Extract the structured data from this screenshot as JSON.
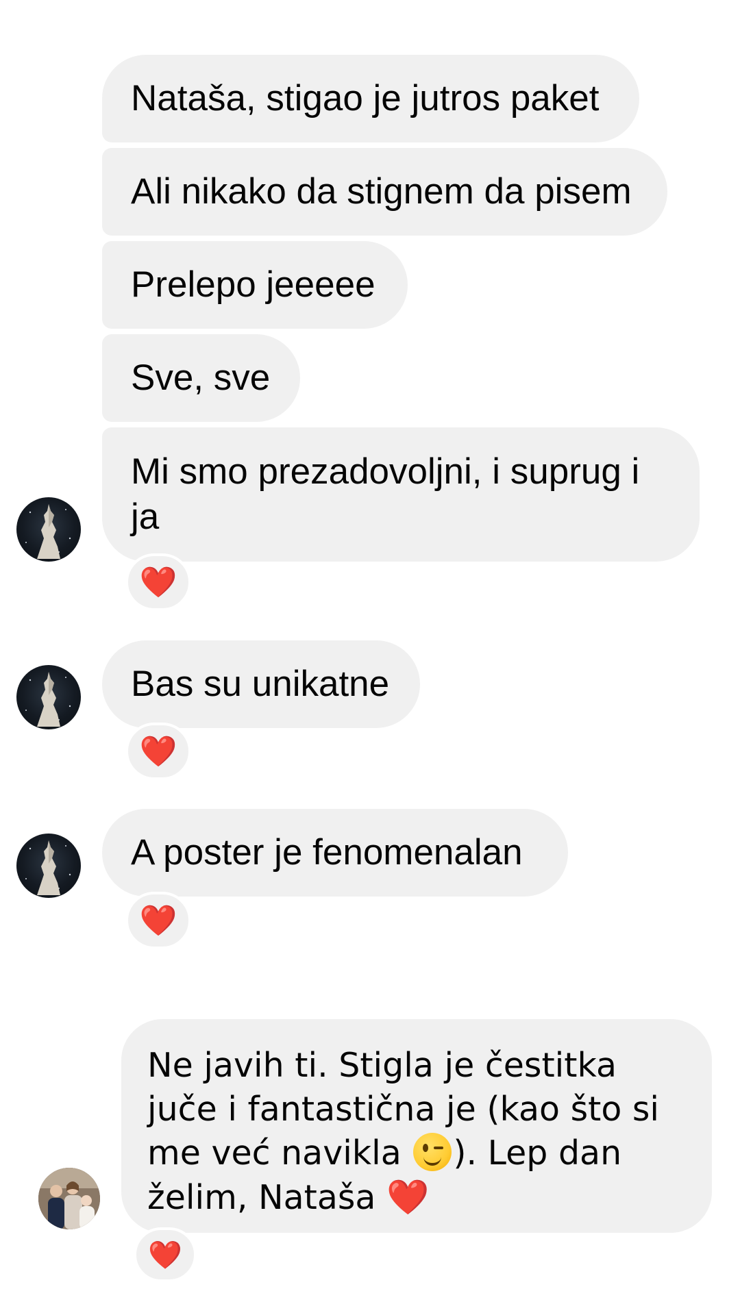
{
  "messages": [
    {
      "text": "Nataša, stigao je jutros paket"
    },
    {
      "text": "Ali nikako da stignem da pisem"
    },
    {
      "text": "Prelepo jeeeee"
    },
    {
      "text": "Sve, sve"
    },
    {
      "text": "Mi smo prezadovoljni, i suprug  i ja",
      "reaction": "❤️"
    },
    {
      "text": "Bas su unikatne",
      "reaction": "❤️"
    },
    {
      "text": "A poster je fenomenalan",
      "reaction": "❤️"
    }
  ],
  "last_message": {
    "text_before_emoji": "Ne javih ti. Stigla je čestitka juče i fantastična je (kao što si me već navikla ",
    "emoji": "winking-face",
    "text_after_emoji": "). Lep dan želim, Nataša ",
    "trailing_emoji": "❤️",
    "reaction": "❤️"
  },
  "colors": {
    "bubble": "#f0f0f0",
    "text": "#050505",
    "heart": "#f02849",
    "background": "#ffffff"
  },
  "icons": {
    "sender_avatar": "statue-avatar-icon",
    "receiver_avatar": "family-photo-avatar",
    "reaction": "heart-icon"
  }
}
